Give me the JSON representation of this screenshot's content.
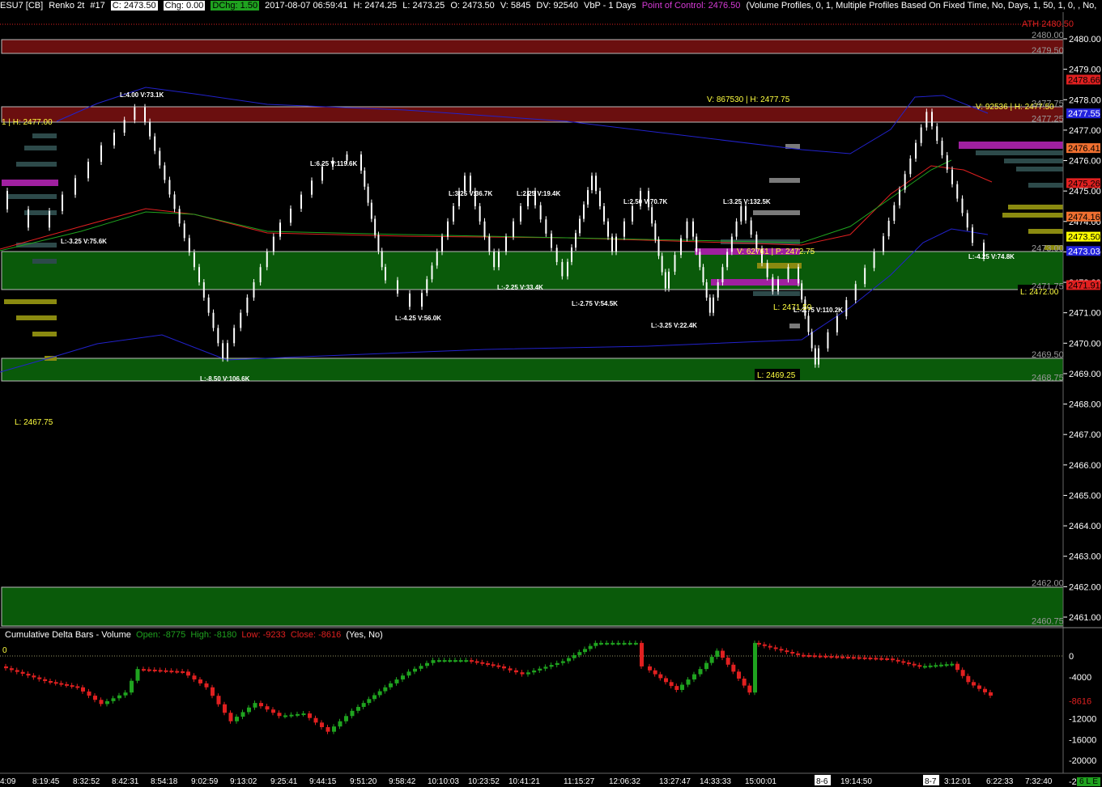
{
  "header": {
    "symbol": "ESU7 [CB]",
    "chart_type": "Renko 2t",
    "chart_number": "#17",
    "close": "C: 2473.50",
    "change": "Chg: 0.00",
    "dchange": "DChg: 1.50",
    "datetime": "2017-08-07 06:59:41",
    "high": "H: 2474.25",
    "low": "L: 2473.25",
    "open": "O: 2473.50",
    "volume": "V: 5845",
    "dv": "DV: 92540",
    "study": "VbP - 1 Days",
    "poc": "Point of Control: 2476.50",
    "params": "(Volume Profiles, 0, 1, Multiple Profiles Based On Fixed Time, No, Days, 1, 50, 1, 0, , No,"
  },
  "price_axis": {
    "ticks": [
      "2480.00",
      "2479.00",
      "2478.00",
      "2477.00",
      "2476.00",
      "2475.00",
      "2474.00",
      "2473.00",
      "2472.00",
      "2471.00",
      "2470.00",
      "2469.00",
      "2468.00",
      "2467.00",
      "2466.00",
      "2465.00",
      "2464.00",
      "2463.00",
      "2462.00",
      "2461.00"
    ],
    "level_labels": [
      "2480.00",
      "2479.50",
      "2477.75",
      "2477.25",
      "2473.00",
      "2471.75",
      "2469.50",
      "2468.75",
      "2462.00",
      "2460.75"
    ],
    "badges": [
      {
        "text": "ATH  2480.50",
        "color": "#e02020",
        "bg": ""
      },
      {
        "text": "2478.66",
        "color": "#000000",
        "bg": "#e02020"
      },
      {
        "text": "2477.55",
        "color": "#ffffff",
        "bg": "#2222dd"
      },
      {
        "text": "2476.41",
        "color": "#000000",
        "bg": "#f07030"
      },
      {
        "text": "2475.26",
        "color": "#000000",
        "bg": "#e02020"
      },
      {
        "text": "2474.16",
        "color": "#000000",
        "bg": "#f07030"
      },
      {
        "text": "2473.50",
        "color": "#000000",
        "bg": "#ffff00"
      },
      {
        "text": "2473.03",
        "color": "#ffffff",
        "bg": "#2222dd"
      },
      {
        "text": "2471.91",
        "color": "#000000",
        "bg": "#e02020"
      }
    ]
  },
  "swing_labels": [
    "L:4.00 V:73.1K",
    "L:-3.25 V:75.6K",
    "L:6.25 V:119.6K",
    "L:-8.50 V:106.6K",
    "L:-4.25 V:56.0K",
    "L:3.25 V:36.7K",
    "L:2.25 V:19.4K",
    "L:-2.25 V:33.4K",
    "L:2.50 V:70.7K",
    "L:-2.75 V:54.5K",
    "L:-3.25 V:22.4K",
    "L:3.25 V:132.5K",
    "L:-2.75 V:110.2K",
    "L:-4.25 V:74.8K"
  ],
  "profile_labels": {
    "left_high": "1 | H: 2477.00",
    "left_low": "L: 2467.75",
    "mid_high": "V: 867530 | H: 2477.75",
    "mid_low": "L: 2469.25",
    "mid_low2": "L: 2471.50",
    "mid_poc": "V: 62761 | P: 2472.75",
    "right_high": "V: 92536 | H: 2477.50",
    "right_low": "L: 2472.00"
  },
  "delta_panel": {
    "title": "Cumulative Delta Bars - Volume",
    "open": "Open: -8775",
    "high": "High: -8180",
    "low": "Low: -9233",
    "close": "Close: -8616",
    "flags": "(Yes, No)",
    "zero_label": "0",
    "ticks": [
      "0",
      "-4000",
      "-8616",
      "-12000",
      "-16000",
      "-20000",
      "-24000"
    ],
    "close_badge": "-8616"
  },
  "time_axis": {
    "labels": [
      "4:09",
      "8:19:45",
      "8:32:52",
      "8:42:31",
      "8:54:18",
      "9:02:59",
      "9:13:02",
      "9:25:41",
      "9:44:15",
      "9:51:20",
      "9:58:42",
      "10:10:03",
      "10:23:52",
      "10:41:21",
      "11:15:27",
      "12:06:32",
      "13:27:47",
      "14:33:33",
      "15:00:01",
      "8-6",
      "19:14:50",
      "8-7",
      "3:12:01",
      "6:22:33",
      "7:32:40"
    ],
    "footer_tag": "6 L E"
  },
  "colors": {
    "background": "#000000",
    "up": "#1fa31f",
    "down": "#e02020",
    "resistance_zone": "#6b0f0f",
    "support_zone": "#0a5a0a",
    "profile_gray": "#7a7a7a",
    "profile_teal": "#2d4a4a",
    "profile_olive": "#8a8a10",
    "profile_magenta": "#a020a0"
  }
}
